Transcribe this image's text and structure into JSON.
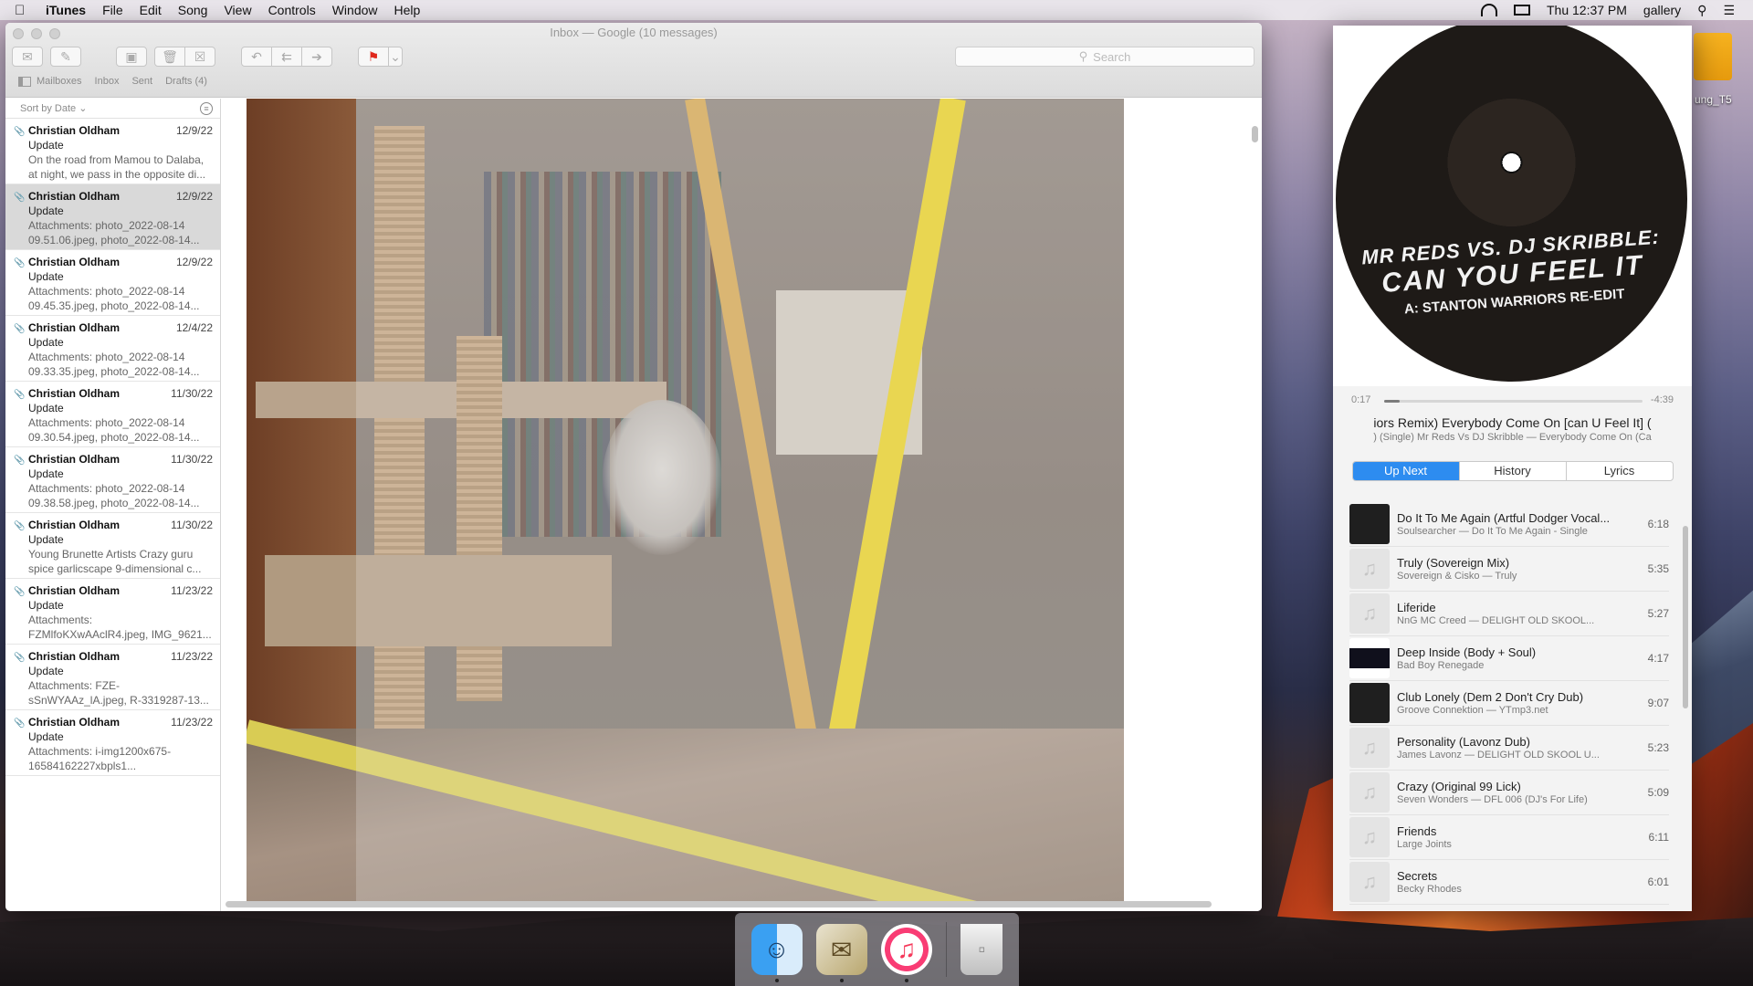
{
  "menubar": {
    "apple": "",
    "app_name": "iTunes",
    "menus": [
      "File",
      "Edit",
      "Song",
      "View",
      "Controls",
      "Window",
      "Help"
    ],
    "clock": "Thu 12:37 PM",
    "user": "gallery"
  },
  "mail": {
    "window_title": "Inbox — Google (10 messages)",
    "search_placeholder": "Search",
    "favorites": {
      "mailboxes": "Mailboxes",
      "inbox": "Inbox",
      "sent": "Sent",
      "drafts": "Drafts (4)"
    },
    "sort_label": "Sort by Date",
    "messages": [
      {
        "from": "Christian Oldham",
        "date": "12/9/22",
        "subject": "Update",
        "preview": "On the road from Mamou to Dalaba, at night, we pass in the opposite di..."
      },
      {
        "from": "Christian Oldham",
        "date": "12/9/22",
        "subject": "Update",
        "preview": "Attachments: photo_2022-08-14 09.51.06.jpeg, photo_2022-08-14..."
      },
      {
        "from": "Christian Oldham",
        "date": "12/9/22",
        "subject": "Update",
        "preview": "Attachments: photo_2022-08-14 09.45.35.jpeg, photo_2022-08-14..."
      },
      {
        "from": "Christian Oldham",
        "date": "12/4/22",
        "subject": "Update",
        "preview": "Attachments: photo_2022-08-14 09.33.35.jpeg, photo_2022-08-14..."
      },
      {
        "from": "Christian Oldham",
        "date": "11/30/22",
        "subject": "Update",
        "preview": "Attachments: photo_2022-08-14 09.30.54.jpeg, photo_2022-08-14..."
      },
      {
        "from": "Christian Oldham",
        "date": "11/30/22",
        "subject": "Update",
        "preview": "Attachments: photo_2022-08-14 09.38.58.jpeg, photo_2022-08-14..."
      },
      {
        "from": "Christian Oldham",
        "date": "11/30/22",
        "subject": "Update",
        "preview": "Young Brunette Artists Crazy guru spice garlicscape 9-dimensional c..."
      },
      {
        "from": "Christian Oldham",
        "date": "11/23/22",
        "subject": "Update",
        "preview": "Attachments: FZMlfoKXwAAclR4.jpeg, IMG_9621..."
      },
      {
        "from": "Christian Oldham",
        "date": "11/23/22",
        "subject": "Update",
        "preview": "Attachments: FZE-sSnWYAAz_lA.jpeg, R-3319287-13..."
      },
      {
        "from": "Christian Oldham",
        "date": "11/23/22",
        "subject": "Update",
        "preview": "Attachments: i-img1200x675-16584162227xbpls1..."
      }
    ],
    "selected_index": 1
  },
  "itunes": {
    "artwork_text": {
      "line1": "MR REDS VS. DJ SKRIBBLE:",
      "line2": "CAN YOU FEEL IT",
      "line3": "A: STANTON WARRIORS RE-EDIT"
    },
    "elapsed": "0:17",
    "remaining": "-4:39",
    "progress_fraction": 0.06,
    "now_playing_title": "iors Remix)   Everybody Come On [can U Feel It] (",
    "now_playing_sub": ") (Single)   Mr Reds Vs DJ Skribble — Everybody Come On (Ca",
    "tabs": [
      "Up Next",
      "History",
      "Lyrics"
    ],
    "active_tab": 0,
    "queue": [
      {
        "title": "Do It To Me Again (Artful Dodger Vocal...",
        "sub": "Soulsearcher — Do It To Me Again - Single",
        "duration": "6:18",
        "art": "dark"
      },
      {
        "title": "Truly (Sovereign Mix)",
        "sub": "Sovereign & Cisko — Truly",
        "duration": "5:35",
        "art": "note"
      },
      {
        "title": "Liferide",
        "sub": "NnG MC Creed — DELIGHT OLD SKOOL...",
        "duration": "5:27",
        "art": "note"
      },
      {
        "title": "Deep Inside (Body + Soul)",
        "sub": "Bad Boy Renegade",
        "duration": "4:17",
        "art": "mixed"
      },
      {
        "title": "Club Lonely (Dem 2 Don't Cry Dub)",
        "sub": "Groove Connektion — YTmp3.net",
        "duration": "9:07",
        "art": "dark"
      },
      {
        "title": "Personality (Lavonz Dub)",
        "sub": "James Lavonz — DELIGHT OLD SKOOL U...",
        "duration": "5:23",
        "art": "note"
      },
      {
        "title": "Crazy (Original 99 Lick)",
        "sub": "Seven Wonders — DFL 006 (DJ's For Life)",
        "duration": "5:09",
        "art": "note"
      },
      {
        "title": "Friends",
        "sub": "Large Joints",
        "duration": "6:11",
        "art": "note"
      },
      {
        "title": "Secrets",
        "sub": "Becky Rhodes",
        "duration": "6:01",
        "art": "note"
      }
    ]
  },
  "desktop": {
    "drive_label": "ung_T5"
  },
  "dock": {
    "apps": [
      "Finder",
      "Mail",
      "iTunes",
      "Trash"
    ]
  },
  "icons": {
    "apple": "apple-icon",
    "music_note": "♫"
  }
}
